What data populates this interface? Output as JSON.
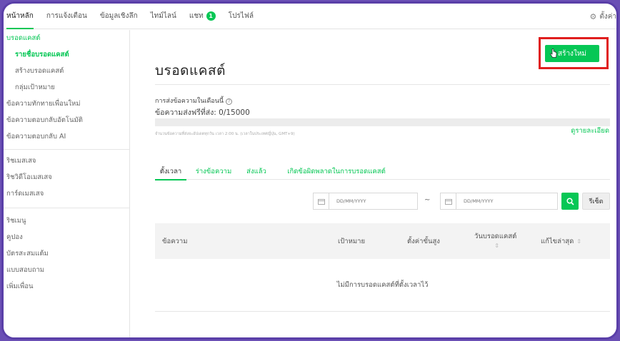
{
  "nav": {
    "items": [
      {
        "label": "หน้าหลัก",
        "active": true
      },
      {
        "label": "การแจ้งเตือน"
      },
      {
        "label": "ข้อมูลเชิงลึก"
      },
      {
        "label": "ไทม์ไลน์"
      },
      {
        "label": "แชท",
        "badge": "1"
      },
      {
        "label": "โปรไฟล์"
      }
    ],
    "settings_label": "ตั้งค่า"
  },
  "sidebar": {
    "groups": [
      {
        "items": [
          {
            "label": "บรอดแคสต์",
            "type": "head"
          },
          {
            "label": "รายชื่อบรอดแคสต์",
            "type": "current"
          },
          {
            "label": "สร้างบรอดแคสต์",
            "type": "sub"
          },
          {
            "label": "กลุ่มเป้าหมาย",
            "type": "sub"
          },
          {
            "label": "ข้อความทักทายเพื่อนใหม่"
          },
          {
            "label": "ข้อความตอบกลับอัตโนมัติ"
          },
          {
            "label": "ข้อความตอบกลับ AI"
          }
        ]
      },
      {
        "items": [
          {
            "label": "ริชเมสเสจ"
          },
          {
            "label": "ริชวิดีโอเมสเสจ"
          },
          {
            "label": "การ์ดเมสเสจ"
          }
        ]
      },
      {
        "items": [
          {
            "label": "ริชเมนู"
          },
          {
            "label": "คูปอง"
          },
          {
            "label": "บัตรสะสมแต้ม"
          },
          {
            "label": "แบบสอบถาม"
          },
          {
            "label": "เพิ่มเพื่อน"
          }
        ]
      }
    ]
  },
  "main": {
    "title": "บรอดแคสต์",
    "create_button": "สร้างใหม่",
    "quota_label": "การส่งข้อความในเดือนนี้",
    "quota_value": "ข้อความส่งฟรีที่ส่ง: 0/15000",
    "quota_fraction": 0,
    "quota_note": "จำนวนข้อความที่ส่งจะอัปเดตทุกวัน เวลา 2:00 น. (เวลาในประเทศญี่ปุ่น, GMT+9)",
    "details_link": "ดูรายละเอียด",
    "tabs": [
      {
        "label": "ตั้งเวลา",
        "active": true
      },
      {
        "label": "ร่างข้อความ"
      },
      {
        "label": "ส่งแล้ว"
      },
      {
        "label": "เกิดข้อผิดพลาดในการบรอดแคสต์"
      }
    ],
    "date_from_placeholder": "DD/MM/YYYY",
    "date_to_placeholder": "DD/MM/YYYY",
    "date_separator": "~",
    "reset_button": "รีเซ็ต",
    "table": {
      "columns": {
        "message": "ข้อความ",
        "target": "เป้าหมาย",
        "advanced": "ตั้งค่าขั้นสูง",
        "broadcast_date": "วันบรอดแคสต์",
        "last_edited": "แก้ไขล่าสุด"
      },
      "empty_text": "ไม่มีการบรอดแคสต์ที่ตั้งเวลาไว้"
    }
  },
  "colors": {
    "brand_green": "#06c755",
    "highlight_red": "#e01e1e",
    "frame_purple": "#5a3fa8"
  },
  "icons": {
    "settings": "gear-icon",
    "calendar": "calendar-icon",
    "search": "search-icon",
    "info": "info-icon",
    "cursor": "hand-cursor-icon"
  }
}
